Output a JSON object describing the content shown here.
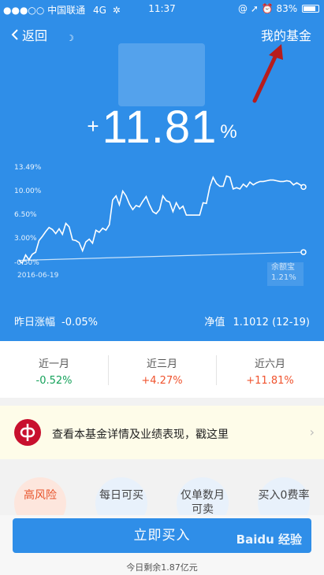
{
  "status_bar": {
    "carrier": "●●●○○ 中国联通",
    "network": "4G",
    "time": "11:37",
    "icons": [
      "at-icon",
      "location-icon",
      "alarm-icon"
    ],
    "battery": "83%"
  },
  "nav": {
    "back_label": "返回",
    "right_label": "我的基金"
  },
  "hero": {
    "plus": "+",
    "return_value": "11.81",
    "return_unit": "%"
  },
  "chart_data": {
    "type": "line",
    "y_tick_labels": [
      "13.49%",
      "10.00%",
      "6.50%",
      "3.00%",
      "-0.50%"
    ],
    "x_start_label": "2016-06-19",
    "ylim": [
      -0.5,
      13.49
    ],
    "series": [
      {
        "values": [
          0.0,
          -0.4,
          0.8,
          0.1,
          0.9,
          1.2,
          2.9,
          3.5,
          4.2,
          4.8,
          4.5,
          3.9,
          4.6,
          3.8,
          5.4,
          4.9,
          3.0,
          2.9,
          2.6,
          1.4,
          2.7,
          3.1,
          2.5,
          4.4,
          4.1,
          4.7,
          4.4,
          5.2,
          8.8,
          9.4,
          8.1,
          10.1,
          9.4,
          8.2,
          7.4,
          8.0,
          7.8,
          8.6,
          9.3,
          8.1,
          7.1,
          6.8,
          7.4,
          9.4,
          8.7,
          8.5,
          7.1,
          8.4,
          7.5,
          7.9,
          6.6,
          6.6,
          6.6,
          6.6,
          6.6,
          8.4,
          8.3,
          10.7,
          12.1,
          11.2,
          10.8,
          10.8,
          12.3,
          12.1,
          10.4,
          10.6,
          10.4,
          11.1,
          10.7,
          11.4,
          11.0,
          11.3,
          11.5,
          11.5,
          11.6,
          11.7,
          11.7,
          11.6,
          11.5,
          11.5,
          11.6,
          11.5,
          11.0,
          11.3,
          11.0,
          10.7
        ]
      },
      {
        "values": [
          0.0,
          1.21
        ]
      }
    ],
    "annotation_name": "余额宝",
    "annotation_value": "1.21%",
    "grid": false
  },
  "metrics": {
    "yesterday_label": "昨日涨幅",
    "yesterday_value": "-0.05%",
    "nav_label": "净值",
    "nav_value": "1.1012",
    "nav_date": "(12-19)"
  },
  "periods": [
    {
      "label": "近一月",
      "value": "-0.52%"
    },
    {
      "label": "近三月",
      "value": "+4.27%"
    },
    {
      "label": "近六月",
      "value": "+11.81%"
    }
  ],
  "banner": {
    "text": "查看本基金详情及业绩表现，戳这里",
    "chevron": "›"
  },
  "tags": [
    "高风险",
    "每日可买",
    "仅单数月可卖",
    "买入0费率"
  ],
  "bottom": {
    "buy_label": "立即买入",
    "remain_text": "今日剩余1.87亿元",
    "watermark": "Baidu 经验"
  },
  "colors": {
    "primary": "#2f8ee8",
    "positive": "#f0532e",
    "negative": "#14a15a",
    "banner_bg": "#fefce9",
    "annotation_arrow": "#b71c1c"
  }
}
